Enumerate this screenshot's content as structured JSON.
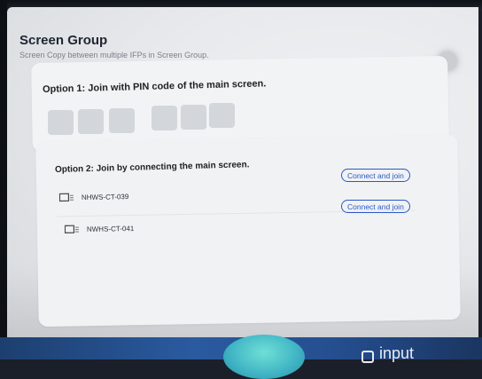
{
  "header": {
    "title": "Screen Group",
    "subtitle": "Screen Copy between multiple IFPs in Screen Group."
  },
  "option1": {
    "label": "Option 1: Join with PIN code of the main screen.",
    "pin_digits": [
      "",
      "",
      "",
      "",
      "",
      ""
    ]
  },
  "option2": {
    "label": "Option 2: Join by connecting the main screen.",
    "devices": [
      {
        "name": "NHWS-CT-039",
        "action": "Connect and join"
      },
      {
        "name": "NWHS-CT-041",
        "action": "Connect and join"
      }
    ]
  },
  "taskbar": {
    "input_label": "input"
  },
  "colors": {
    "accent": "#2a58c8",
    "card": "#f2f3f5",
    "pin_box": "#d3d6da",
    "taskbar": "#2a5aa0"
  }
}
